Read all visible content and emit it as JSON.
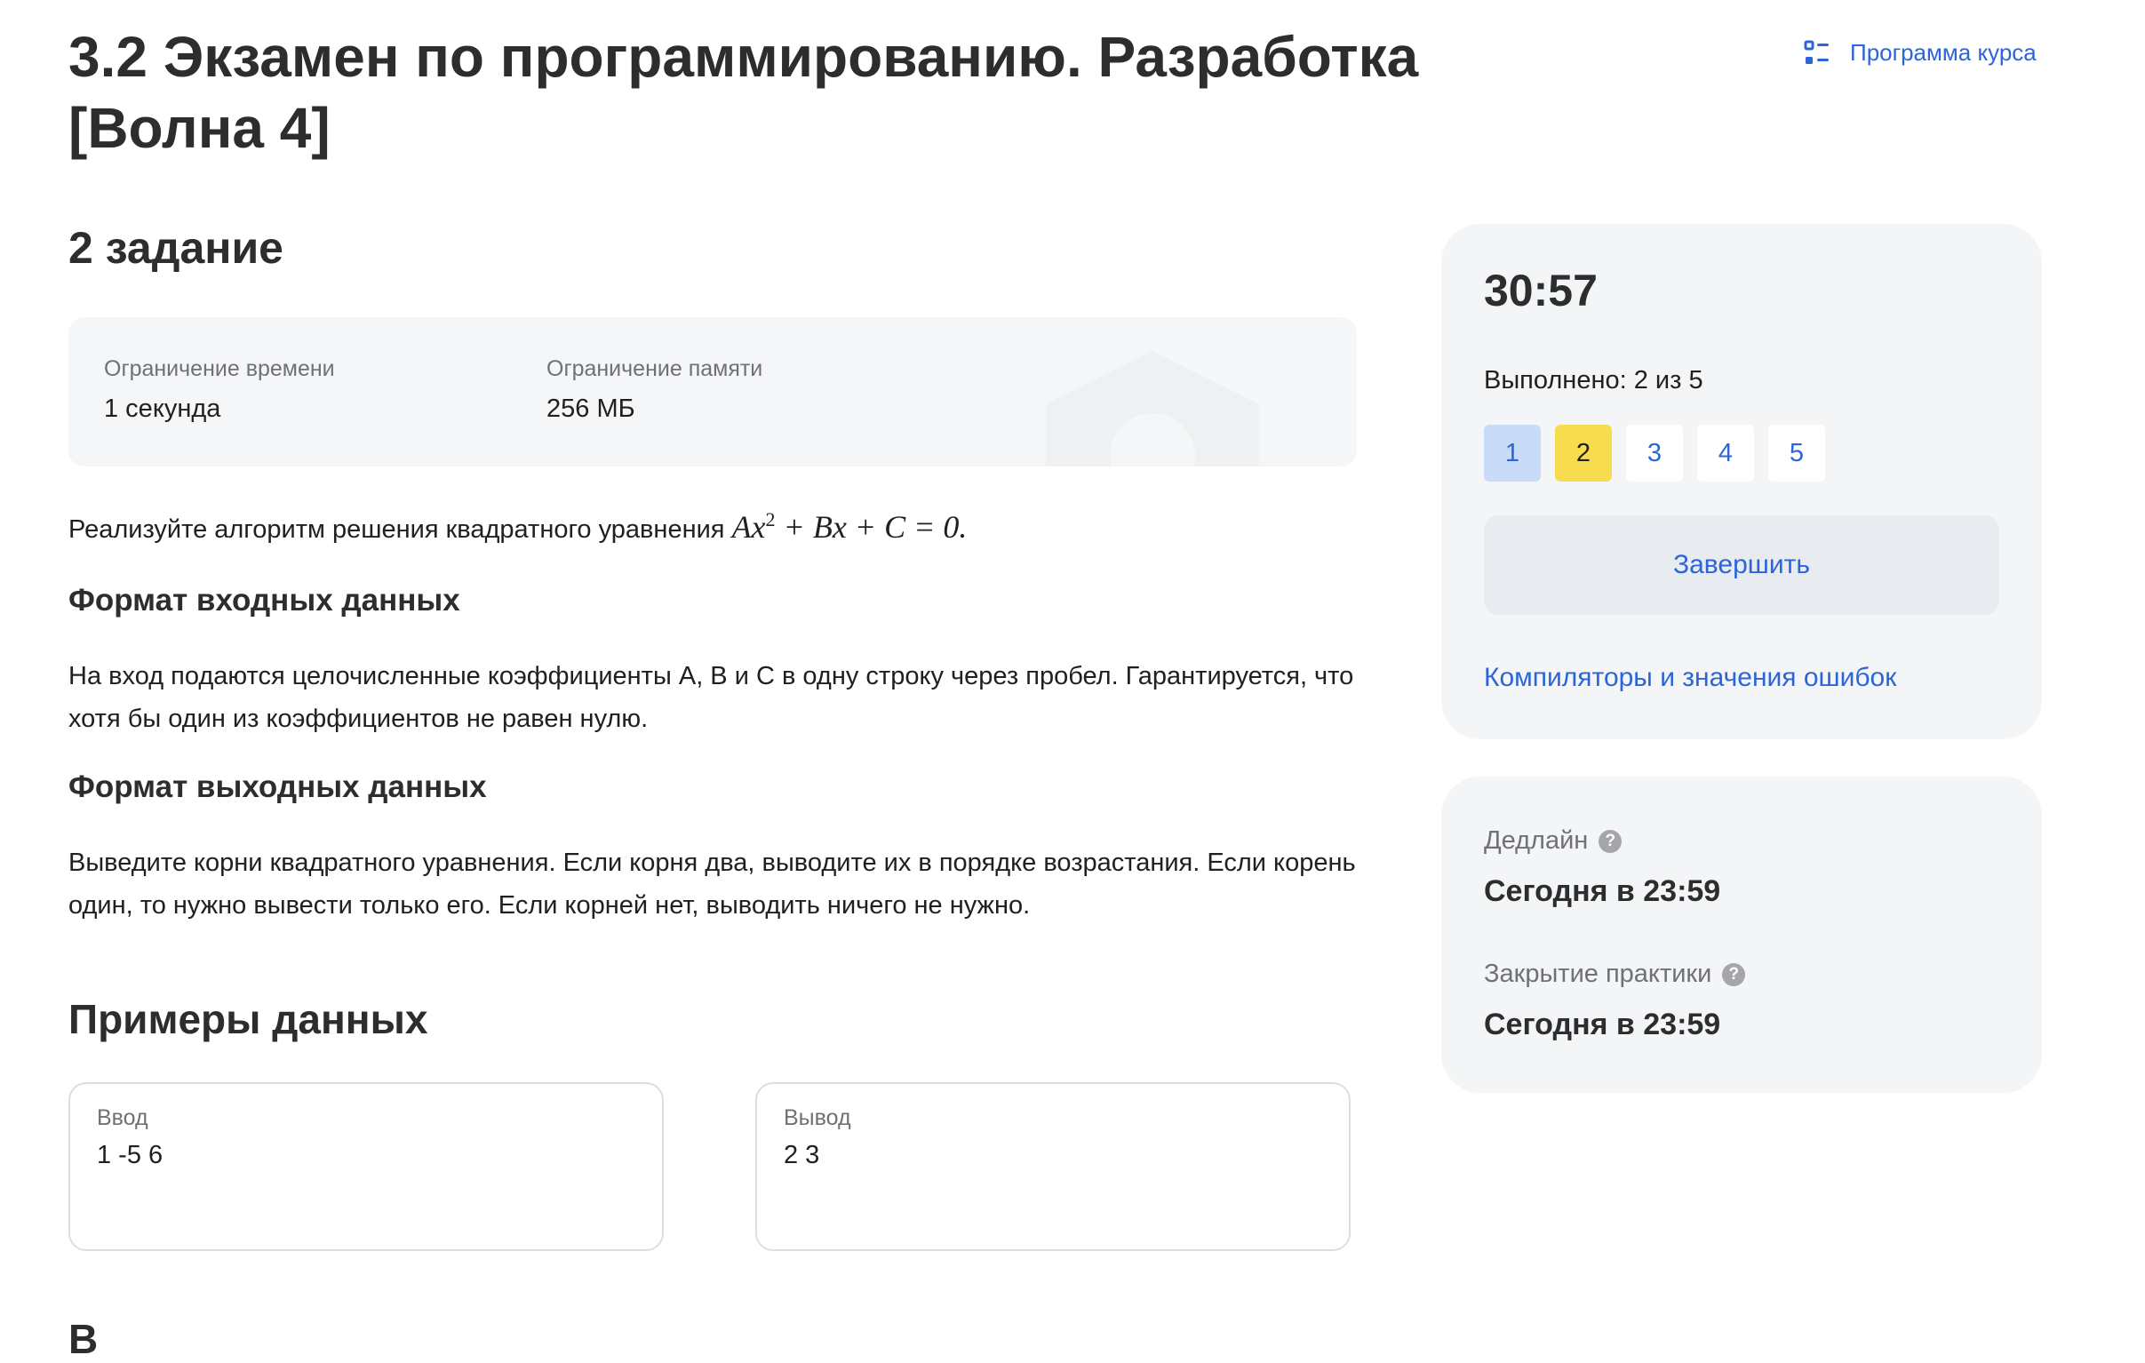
{
  "header": {
    "title": "3.2 Экзамен по программированию. Разработка [Волна 4]",
    "program_link": "Программа курса",
    "program_icon": "list-icon"
  },
  "task": {
    "title": "2 задание",
    "limits": {
      "time_label": "Ограничение времени",
      "time_value": "1 секунда",
      "memory_label": "Ограничение памяти",
      "memory_value": "256 МБ"
    },
    "statement": "Реализуйте алгоритм решения квадратного уравнения",
    "formula": {
      "a_part": "Ax",
      "exponent": "2",
      "rest": " + Bx + C = 0."
    },
    "input_heading": "Формат входных данных",
    "input_text": "На вход подаются целочисленные коэффициенты A, B и C в одну строку через пробел. Гарантируется, что хотя бы один из коэффициентов не равен нулю.",
    "output_heading": "Формат выходных данных",
    "output_text": "Выведите корни квадратного уравнения. Если корня два, выводите их в порядке возрастания. Если корень один, то нужно вывести только его. Если корней нет, выводить ничего не нужно.",
    "examples_heading": "Примеры данных",
    "example": {
      "input_label": "Ввод",
      "input_value": "1 -5 6",
      "output_label": "Вывод",
      "output_value": "2 3"
    },
    "cut_off_text": "В"
  },
  "sidebar": {
    "timer": "30:57",
    "progress": "Выполнено: 2 из 5",
    "tasks": [
      {
        "label": "1",
        "state": "done"
      },
      {
        "label": "2",
        "state": "current"
      },
      {
        "label": "3",
        "state": "pending"
      },
      {
        "label": "4",
        "state": "pending"
      },
      {
        "label": "5",
        "state": "pending"
      }
    ],
    "finish_button": "Завершить",
    "compilers_link": "Компиляторы и значения ошибок",
    "deadline_label": "Дедлайн",
    "deadline_value": "Сегодня в 23:59",
    "closing_label": "Закрытие практики",
    "closing_value": "Сегодня в 23:59",
    "help_icon": "question-circle-icon"
  },
  "colors": {
    "accent": "#2b65d9",
    "current_task": "#f8dc4f",
    "done_task": "#c8dbf8",
    "card_bg": "#f4f5f6"
  }
}
